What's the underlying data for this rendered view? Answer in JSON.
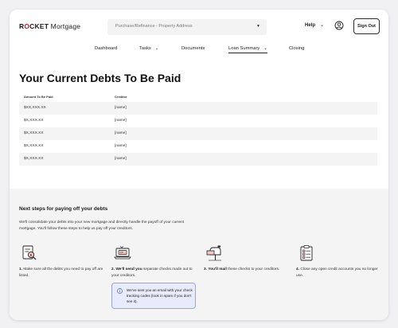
{
  "header": {
    "logo_prefix": "R",
    "logo_o": "O",
    "logo_suffix": "CKET",
    "logo_mortgage": "Mortgage",
    "address_select": "Purchase/Refinance - Property Address",
    "help_label": "Help",
    "signout_label": "Sign Out"
  },
  "nav": {
    "items": [
      {
        "label": "Dashboard"
      },
      {
        "label": "Tasks"
      },
      {
        "label": "Documents"
      },
      {
        "label": "Loan Summary"
      },
      {
        "label": "Closing"
      }
    ]
  },
  "debts": {
    "title": "Your Current Debts To Be Paid",
    "col_amount": "Amount To Be Paid",
    "col_creditor": "Creditor",
    "rows": [
      {
        "amount": "$XX,XXX.XX",
        "creditor": "[name]"
      },
      {
        "amount": "$X,XXX.XX",
        "creditor": "[name]"
      },
      {
        "amount": "$X,XXX.XX",
        "creditor": "[name]"
      },
      {
        "amount": "$X,XXX.XX",
        "creditor": "[name]"
      },
      {
        "amount": "$X,XXX.XX",
        "creditor": "[name]"
      }
    ]
  },
  "next_steps": {
    "title": "Next steps for paying off your debts",
    "description": "We'll consolidate your debts into your new mortgage and directly handle the payoff of your current mortgage. You'll follow these steps to help us pay off your creditors.",
    "steps": [
      {
        "num": "1.",
        "bold": "",
        "text": "Make sure all the debts you need to pay off are listed."
      },
      {
        "num": "2.",
        "bold": "We'll send you",
        "text": " separate checks made out to your creditors."
      },
      {
        "num": "3.",
        "bold": "You'll mail",
        "text": " these checks to your creditors."
      },
      {
        "num": "4.",
        "bold": "",
        "text": "Close any open credit accounts you no longer use."
      }
    ],
    "note": "We've sent you an email with your check tracking codes (look in spam if you don't see it)."
  },
  "colors": {
    "brand_red": "#c8102e",
    "note_bg": "#e8ebfb",
    "note_border": "#9aa4e3"
  }
}
